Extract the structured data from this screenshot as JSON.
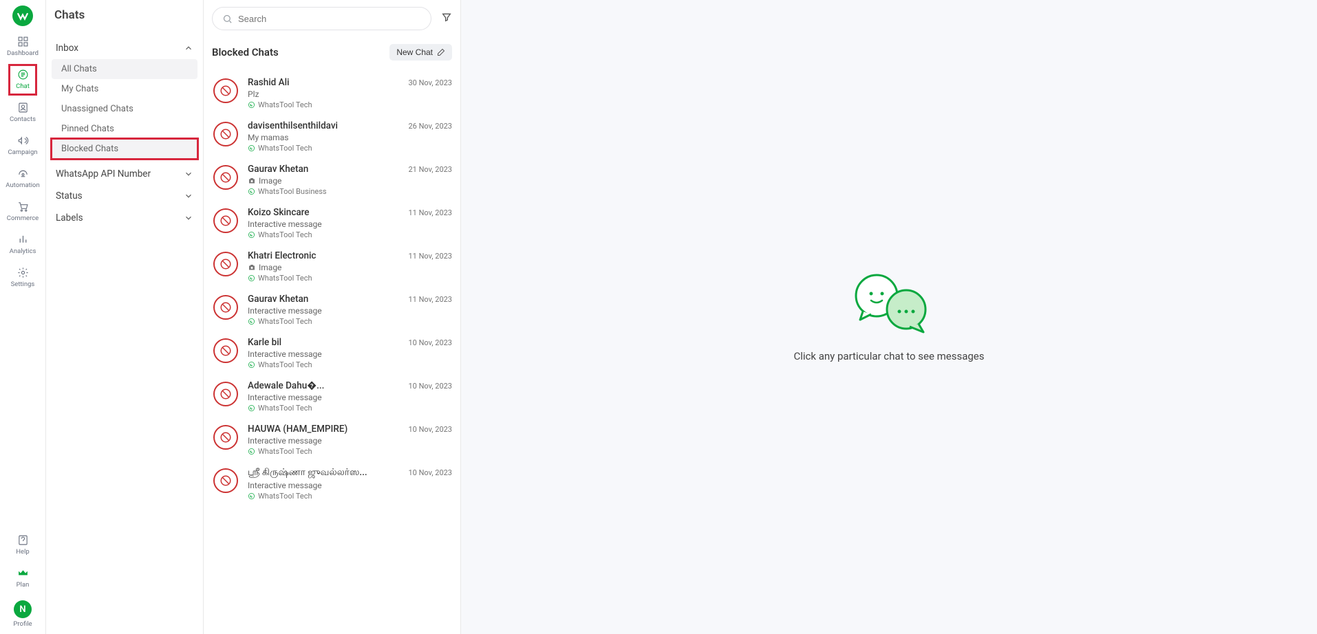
{
  "nav": {
    "dashboard": "Dashboard",
    "chat": "Chat",
    "contacts": "Contacts",
    "campaign": "Campaign",
    "automation": "Automation",
    "commerce": "Commerce",
    "analytics": "Analytics",
    "settings": "Settings",
    "help": "Help",
    "plan": "Plan",
    "profile": "Profile",
    "profile_initial": "N"
  },
  "sidebar": {
    "title": "Chats",
    "sections": {
      "inbox": {
        "label": "Inbox",
        "items": [
          "All Chats",
          "My Chats",
          "Unassigned Chats",
          "Pinned Chats",
          "Blocked Chats"
        ]
      },
      "api": {
        "label": "WhatsApp API Number"
      },
      "status": {
        "label": "Status"
      },
      "labels": {
        "label": "Labels"
      }
    }
  },
  "search": {
    "placeholder": "Search"
  },
  "list": {
    "title": "Blocked Chats",
    "new_chat": "New Chat",
    "items": [
      {
        "name": "Rashid Ali",
        "msg": "Plz",
        "date": "30 Nov, 2023",
        "source": "WhatsTool Tech",
        "image": false
      },
      {
        "name": "davisenthilsenthildavi",
        "msg": "My mamas",
        "date": "26 Nov, 2023",
        "source": "WhatsTool Tech",
        "image": false
      },
      {
        "name": "Gaurav Khetan",
        "msg": "Image",
        "date": "21 Nov, 2023",
        "source": "WhatsTool Business",
        "image": true
      },
      {
        "name": "Koizo Skincare",
        "msg": "Interactive message",
        "date": "11 Nov, 2023",
        "source": "WhatsTool Tech",
        "image": false
      },
      {
        "name": "Khatri Electronic",
        "msg": "Image",
        "date": "11 Nov, 2023",
        "source": "WhatsTool Tech",
        "image": true
      },
      {
        "name": "Gaurav Khetan",
        "msg": "Interactive message",
        "date": "11 Nov, 2023",
        "source": "WhatsTool Tech",
        "image": false
      },
      {
        "name": "Karle bil",
        "msg": "Interactive message",
        "date": "10 Nov, 2023",
        "source": "WhatsTool Tech",
        "image": false
      },
      {
        "name": "Adewale Dahu�...",
        "msg": "Interactive message",
        "date": "10 Nov, 2023",
        "source": "WhatsTool Tech",
        "image": false
      },
      {
        "name": "HAUWA (HAM_EMPIRE)",
        "msg": "Interactive message",
        "date": "10 Nov, 2023",
        "source": "WhatsTool Tech",
        "image": false
      },
      {
        "name": "ஸ்ரீ கிருஷ்ணா ஜுவல்லர்ஸ...",
        "msg": "Interactive message",
        "date": "10 Nov, 2023",
        "source": "WhatsTool Tech",
        "image": false
      }
    ]
  },
  "main": {
    "empty_text": "Click any particular chat to see messages"
  }
}
